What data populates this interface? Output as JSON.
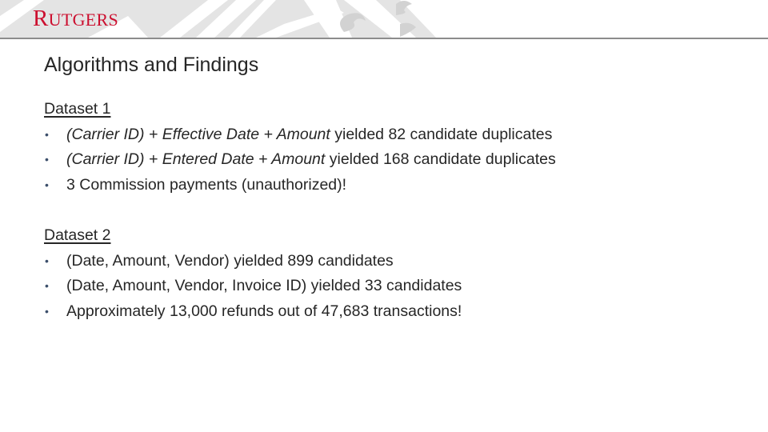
{
  "header": {
    "logo_initial": "R",
    "logo_rest": "UTGERS",
    "logo_color": "#cc0f2f",
    "watermark": "seal-watermark"
  },
  "slide": {
    "title": "Algorithms and Findings",
    "bullet_color": "#3c4f6b",
    "sections": [
      {
        "heading": "Dataset 1",
        "items": [
          {
            "italic": "(Carrier ID) + Effective Date + Amount",
            "text": " yielded 82 candidate duplicates"
          },
          {
            "italic": "(Carrier ID) + Entered Date + Amount",
            "text": " yielded 168 candidate duplicates"
          },
          {
            "italic": "",
            "text": "3 Commission payments (unauthorized)!"
          }
        ]
      },
      {
        "heading": "Dataset 2",
        "items": [
          {
            "italic": "",
            "text": "(Date, Amount, Vendor) yielded 899 candidates"
          },
          {
            "italic": "",
            "text": "(Date, Amount, Vendor, Invoice ID) yielded 33 candidates"
          },
          {
            "italic": "",
            "text": "Approximately 13,000 refunds out of 47,683 transactions!"
          }
        ]
      }
    ],
    "bullet_glyph": "•"
  }
}
